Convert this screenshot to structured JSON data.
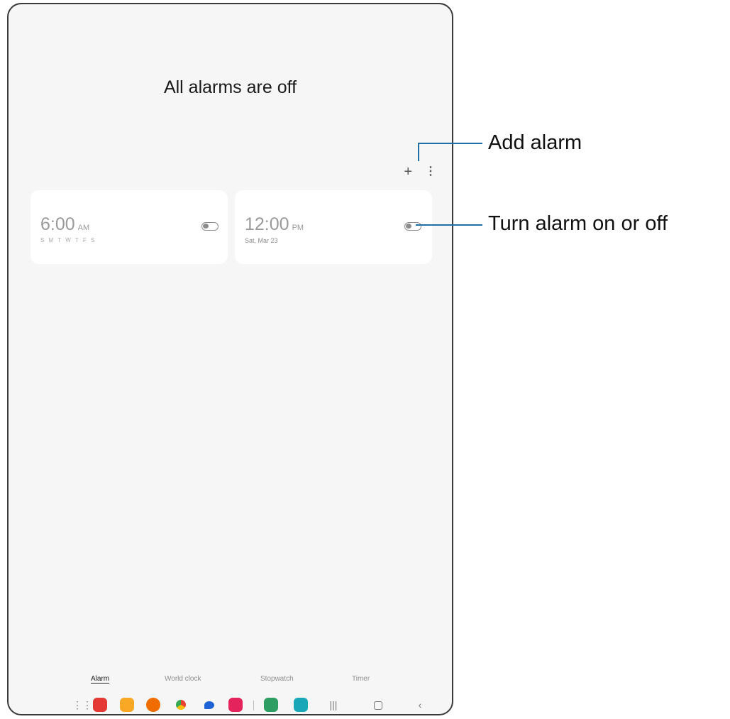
{
  "headline": "All alarms are off",
  "icons": {
    "add": "+",
    "more": "⋮"
  },
  "alarms": [
    {
      "time": "6:00",
      "ampm": "AM",
      "sub": "S M T W T F S"
    },
    {
      "time": "12:00",
      "ampm": "PM",
      "sub": "Sat, Mar 23"
    }
  ],
  "tabs": [
    "Alarm",
    "World clock",
    "Stopwatch",
    "Timer"
  ],
  "callouts": {
    "add_alarm": "Add alarm",
    "toggle_alarm": "Turn alarm on or off"
  },
  "colors": {
    "callout_line": "#1d6fa5",
    "background": "#f6f6f6"
  }
}
